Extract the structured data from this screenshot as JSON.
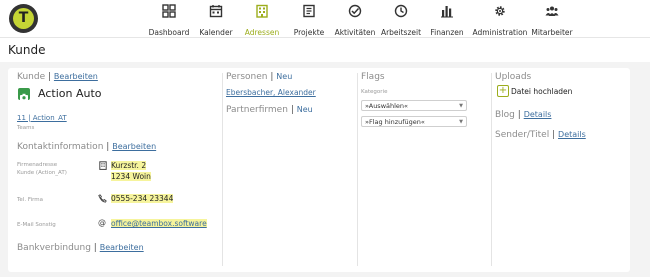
{
  "nav": {
    "items": [
      {
        "key": "dashboard",
        "label": "Dashboard",
        "icon": "grid-icon"
      },
      {
        "key": "kalender",
        "label": "Kalender",
        "icon": "calendar-icon"
      },
      {
        "key": "adressen",
        "label": "Adressen",
        "icon": "building-icon",
        "active": true
      },
      {
        "key": "projekte",
        "label": "Projekte",
        "icon": "notebook-icon"
      },
      {
        "key": "aktivitaeten",
        "label": "Aktivitäten",
        "icon": "check-circle-icon"
      },
      {
        "key": "arbeitszeit",
        "label": "Arbeitszeit",
        "icon": "clock-icon"
      },
      {
        "key": "finanzen",
        "label": "Finanzen",
        "icon": "bar-chart-icon"
      },
      {
        "key": "administration",
        "label": "Administration",
        "icon": "gear-icon"
      },
      {
        "key": "mitarbeiter",
        "label": "Mitarbeiter",
        "icon": "users-icon"
      }
    ],
    "accent_color": "#9cad1c"
  },
  "page": {
    "title": "Kunde"
  },
  "kunde": {
    "heading": "Kunde",
    "separator": "|",
    "edit_label": "Bearbeiten",
    "name": "Action Auto",
    "team_link": "11 | Action_AT",
    "team_caption": "Teams"
  },
  "kontakt": {
    "heading": "Kontaktinformation",
    "separator": "|",
    "edit_label": "Bearbeiten",
    "address_label_1": "Firmenadresse",
    "address_label_2": "Kunde (Action_AT)",
    "street": "Kurzstr. 2",
    "city": "1234 Woin",
    "phone_label": "Tel. Firma",
    "phone": "0555-234 23344",
    "email_label": "E-Mail Sonstig",
    "email": "office@teambox.software"
  },
  "bank": {
    "heading": "Bankverbindung",
    "separator": "|",
    "edit_label": "Bearbeiten"
  },
  "personen": {
    "heading": "Personen",
    "separator": "|",
    "new_label": "Neu",
    "person": "Ebersbacher, Alexander"
  },
  "partner": {
    "heading": "Partnerfirmen",
    "separator": "|",
    "new_label": "Neu"
  },
  "flags": {
    "heading": "Flags",
    "category_label": "Kategorie",
    "select_1": "»Auswählen«",
    "select_2": "»Flag hinzufügen«"
  },
  "uploads": {
    "heading": "Uploads",
    "upload_label": "Datei hochladen"
  },
  "blog": {
    "heading": "Blog",
    "separator": "|",
    "details_label": "Details"
  },
  "sender": {
    "heading": "Sender/Titel",
    "separator": "|",
    "details_label": "Details"
  }
}
